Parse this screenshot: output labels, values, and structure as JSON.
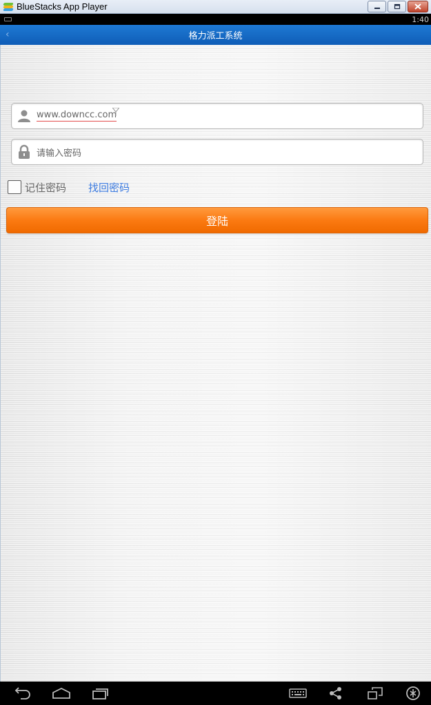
{
  "window": {
    "title": "BlueStacks App Player",
    "minimize_label": "▭",
    "restore_label": "⧉",
    "close_label": "✕"
  },
  "status_bar": {
    "time": "1:40"
  },
  "action_bar": {
    "title": "格力派工系统",
    "back_label": "‹"
  },
  "login_form": {
    "username_value": "www.downcc.com",
    "password_placeholder": "请输入密码",
    "remember_label": "记住密码",
    "forgot_label": "找回密码",
    "login_label": "登陆"
  },
  "colors": {
    "action_bar": "#1565c0",
    "login_button": "#fb7a12",
    "link": "#3c7be0"
  },
  "nav_bar": {
    "icons": [
      "back-icon",
      "home-icon",
      "recent-apps-icon",
      "keyboard-icon",
      "share-icon",
      "window-icon",
      "settings-icon"
    ]
  }
}
